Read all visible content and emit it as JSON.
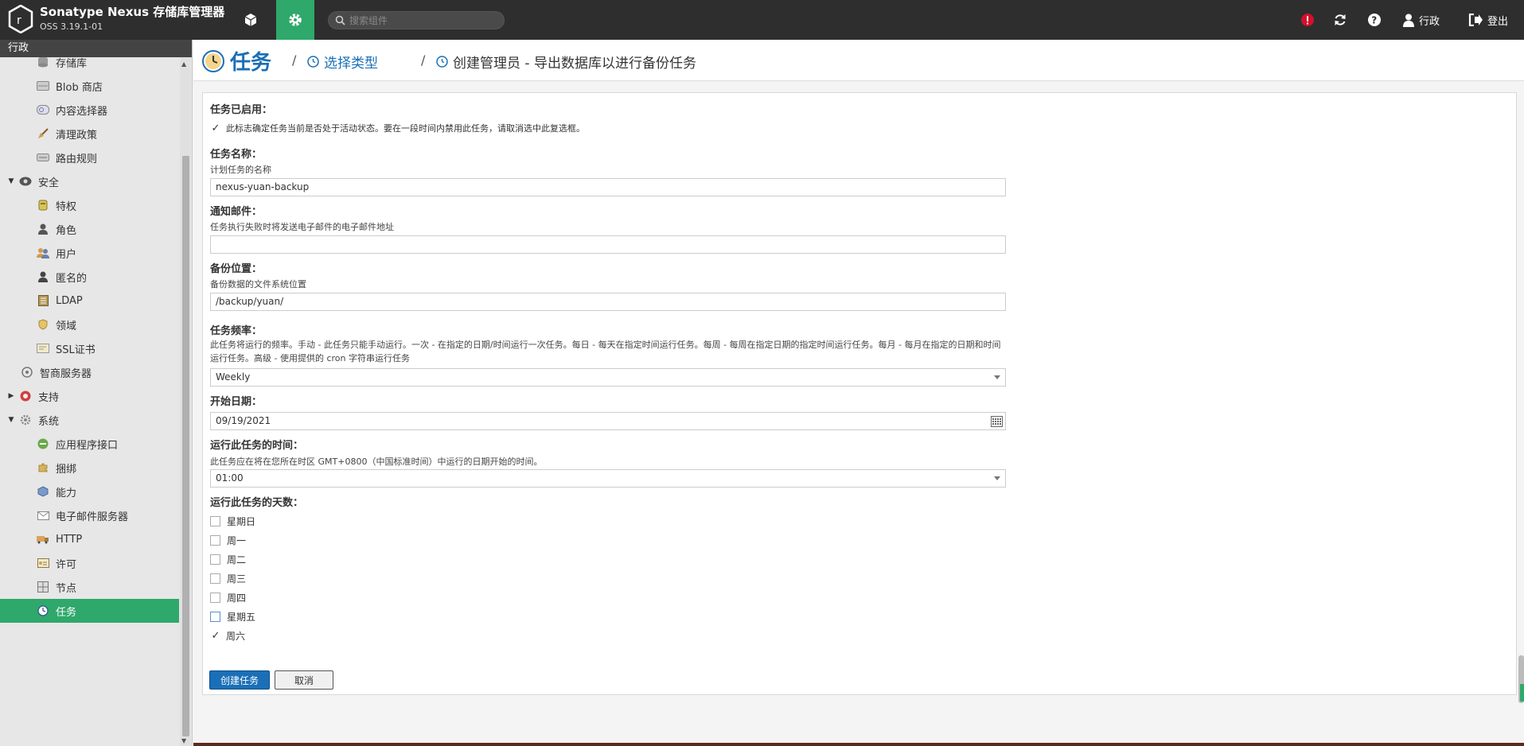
{
  "header": {
    "title": "Sonatype Nexus 存储库管理器",
    "version": "OSS 3.19.1-01",
    "search_placeholder": "搜索组件",
    "user_label": "行政",
    "logout_label": "登出"
  },
  "sidebar": {
    "section_title": "行政",
    "items": [
      {
        "label": "存储库",
        "icon": "database-icon"
      },
      {
        "label": "Blob 商店",
        "icon": "blob-store-icon"
      },
      {
        "label": "内容选择器",
        "icon": "content-selector-icon"
      },
      {
        "label": "清理政策",
        "icon": "broom-icon"
      },
      {
        "label": "路由规则",
        "icon": "routing-rule-icon"
      },
      {
        "label": "安全",
        "icon": "security-icon"
      },
      {
        "label": "特权",
        "icon": "privilege-icon"
      },
      {
        "label": "角色",
        "icon": "role-icon"
      },
      {
        "label": "用户",
        "icon": "users-icon"
      },
      {
        "label": "匿名的",
        "icon": "anonymous-icon"
      },
      {
        "label": "LDAP",
        "icon": "ldap-icon"
      },
      {
        "label": "领域",
        "icon": "realm-icon"
      },
      {
        "label": "SSL证书",
        "icon": "certificate-icon"
      },
      {
        "label": "智商服务器",
        "icon": "iq-server-icon"
      },
      {
        "label": "支持",
        "icon": "support-icon"
      },
      {
        "label": "系统",
        "icon": "system-gear-icon"
      },
      {
        "label": "应用程序接口",
        "icon": "api-icon"
      },
      {
        "label": "捆绑",
        "icon": "bundle-icon"
      },
      {
        "label": "能力",
        "icon": "capability-icon"
      },
      {
        "label": "电子邮件服务器",
        "icon": "email-icon"
      },
      {
        "label": "HTTP",
        "icon": "http-truck-icon"
      },
      {
        "label": "许可",
        "icon": "license-icon"
      },
      {
        "label": "节点",
        "icon": "nodes-icon"
      },
      {
        "label": "任务",
        "icon": "clock-icon"
      }
    ]
  },
  "breadcrumb": {
    "root": "任务",
    "step1": "选择类型",
    "step2": "创建管理员 - 导出数据库以进行备份任务"
  },
  "form": {
    "enabled_label": "任务已启用：",
    "enabled_help": "此标志确定任务当前是否处于活动状态。要在一段时间内禁用此任务，请取消选中此复选框。",
    "name_label": "任务名称：",
    "name_help": "计划任务的名称",
    "name_value": "nexus-yuan-backup",
    "email_label": "通知邮件：",
    "email_help": "任务执行失败时将发送电子邮件的电子邮件地址",
    "email_value": "",
    "location_label": "备份位置：",
    "location_help": "备份数据的文件系统位置",
    "location_value": "/backup/yuan/",
    "frequency_label": "任务频率：",
    "frequency_help": "此任务将运行的频率。手动 - 此任务只能手动运行。一次 - 在指定的日期/时间运行一次任务。每日 - 每天在指定时间运行任务。每周 - 每周在指定日期的指定时间运行任务。每月 - 每月在指定的日期和时间运行任务。高级 - 使用提供的 cron 字符串运行任务",
    "frequency_value": "Weekly",
    "start_label": "开始日期：",
    "start_value": "09/19/2021",
    "time_label": "运行此任务的时间：",
    "time_help": "此任务应在将在您所在时区 GMT+0800（中国标准时间）中运行的日期开始的时间。",
    "time_value": "01:00",
    "days_label": "运行此任务的天数：",
    "days": [
      {
        "label": "星期日",
        "checked": false
      },
      {
        "label": "周一",
        "checked": false
      },
      {
        "label": "周二",
        "checked": false
      },
      {
        "label": "周三",
        "checked": false
      },
      {
        "label": "周四",
        "checked": false
      },
      {
        "label": "星期五",
        "checked": false
      },
      {
        "label": "周六",
        "checked": true
      }
    ],
    "create_button": "创建任务",
    "cancel_button": "取消"
  }
}
